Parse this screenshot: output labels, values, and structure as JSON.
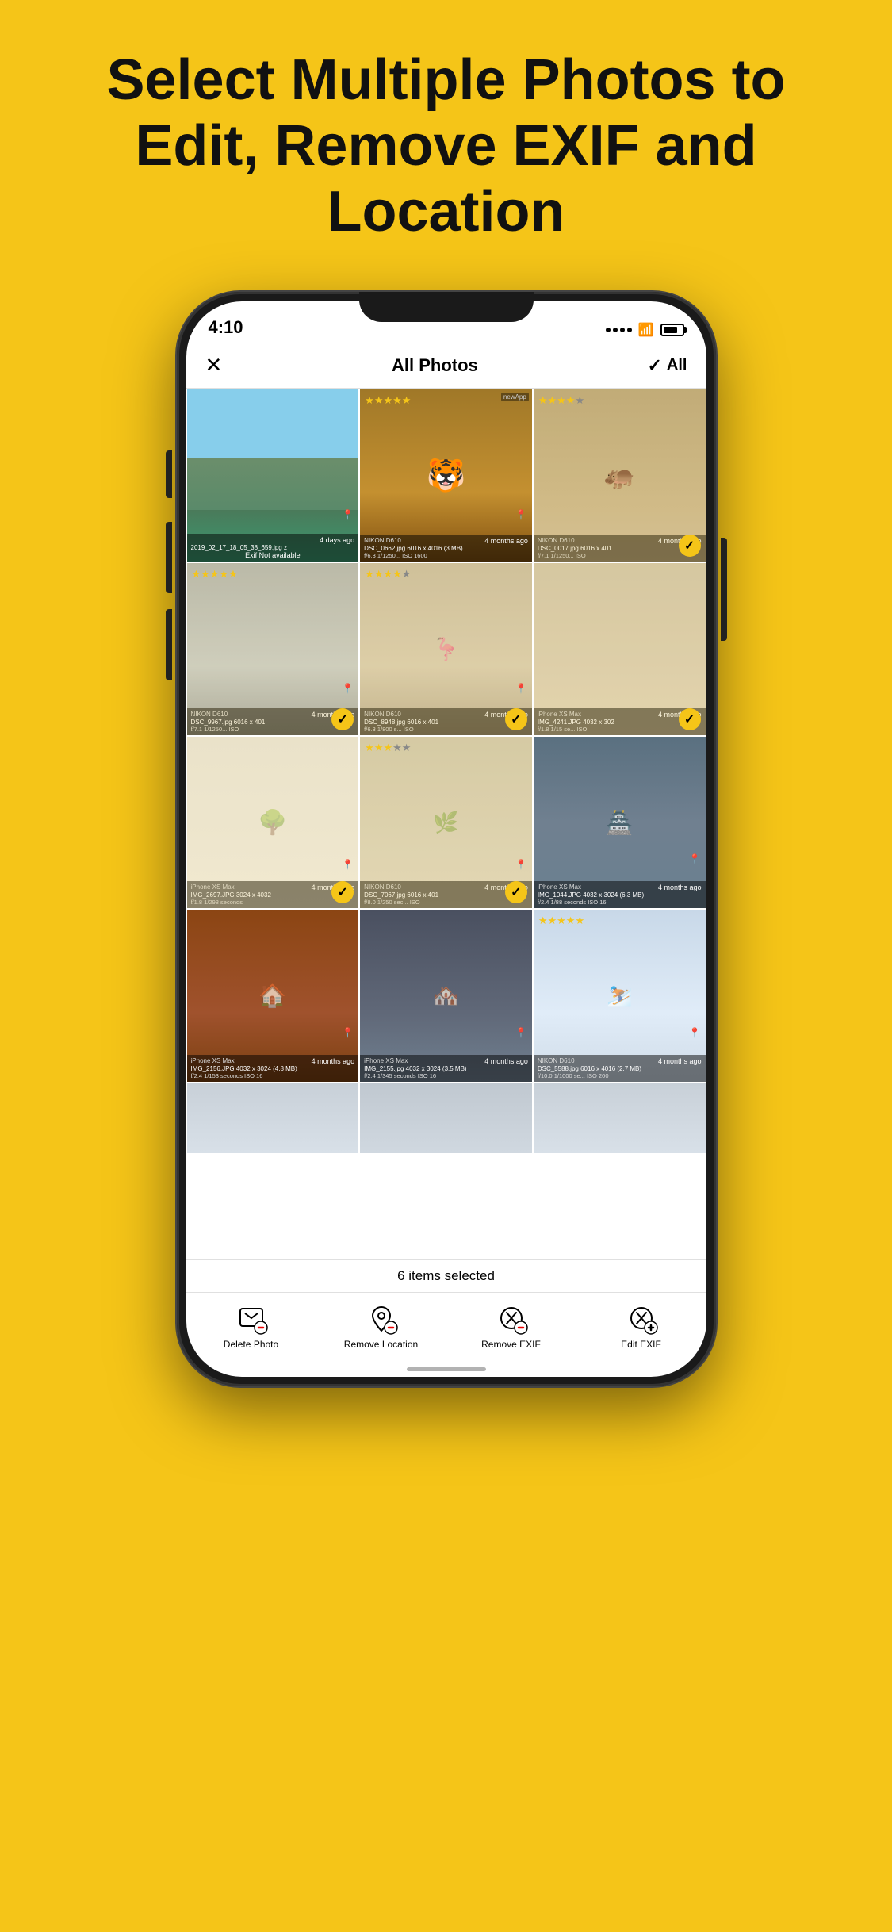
{
  "background_color": "#F5C518",
  "headline": {
    "line1": "Select Multiple Photos to",
    "line2": "Edit, Remove EXIF and Location"
  },
  "status_bar": {
    "time": "4:10"
  },
  "nav": {
    "title": "All Photos",
    "select_all_label": "All"
  },
  "photos": [
    {
      "id": "p1",
      "scene": "mountain",
      "date": "4 days ago",
      "filename": "2019_02_17_18_05_38_659.jpg z",
      "exif1": "Exif Not available",
      "camera": "",
      "has_location": true,
      "selected": false,
      "stars": 0
    },
    {
      "id": "p2",
      "scene": "tiger",
      "date": "4 months ago",
      "filename": "DSC_0662.jpg 6016 x 4016 (3 MB)",
      "exif1": "f/6.3    1/1250...  ISO 1600",
      "camera": "NIKON D610",
      "has_location": true,
      "selected": false,
      "stars": 5
    },
    {
      "id": "p3",
      "scene": "hippo",
      "date": "4 months ago",
      "filename": "DSC_0017.jpg 6016 x 401...",
      "exif1": "f/7.1    1/1250...  ISO",
      "camera": "NIKON D610",
      "has_location": false,
      "selected": true,
      "stars": 4
    },
    {
      "id": "p4",
      "scene": "gray1",
      "date": "4 months ago",
      "filename": "DSC_9967.jpg 6016 x 401",
      "exif1": "f/7.1    1/1250...  ISO",
      "camera": "NIKON D610",
      "has_location": true,
      "selected": true,
      "stars": 5
    },
    {
      "id": "p5",
      "scene": "bird",
      "date": "4 months ago",
      "filename": "DSC_8948.jpg 6016 x 401",
      "exif1": "f/6.3    1/800 s...  ISO",
      "camera": "NIKON D610",
      "has_location": true,
      "selected": true,
      "stars": 4
    },
    {
      "id": "p6",
      "scene": "beige",
      "date": "4 months ago",
      "filename": "IMG_4241.JPG 4032 x 302",
      "exif1": "f/1.8    1/15 se...  ISO",
      "camera": "iPhone XS Max",
      "has_location": false,
      "selected": true,
      "stars": 0
    },
    {
      "id": "p7",
      "scene": "trees1",
      "date": "4 months ago",
      "filename": "IMG_2697.JPG 3024 x 4032",
      "exif1": "f/1.8    1/298 seconds",
      "camera": "iPhone XS Max",
      "has_location": true,
      "selected": true,
      "stars": 0
    },
    {
      "id": "p8",
      "scene": "trees2",
      "date": "4 months ago",
      "filename": "DSC_7067.jpg 6016 x 401",
      "exif1": "f/8.0    1/250 sec...  ISO",
      "camera": "NIKON D610",
      "has_location": true,
      "selected": true,
      "stars": 3
    },
    {
      "id": "p9",
      "scene": "pavilion",
      "date": "4 months ago",
      "filename": "IMG_1044.JPG 4032 x 3024 (6.3 MB)",
      "exif1": "f/2.4    1/88 seconds  ISO 16",
      "camera": "iPhone XS Max",
      "has_location": true,
      "selected": false,
      "stars": 0
    },
    {
      "id": "p10",
      "scene": "house1",
      "date": "4 months ago",
      "filename": "IMG_2156.JPG 4032 x 3024 (4.8 MB)",
      "exif1": "f/2.4    1/153 seconds  ISO 16",
      "camera": "iPhone XS Max",
      "has_location": true,
      "selected": false,
      "stars": 0
    },
    {
      "id": "p11",
      "scene": "house2",
      "date": "4 months ago",
      "filename": "IMG_2155.jpg 4032 x 3024 (3.5 MB)",
      "exif1": "f/2.4    1/345 seconds  ISO 16",
      "camera": "iPhone XS Max",
      "has_location": true,
      "selected": false,
      "stars": 0
    },
    {
      "id": "p12",
      "scene": "snow",
      "date": "4 months ago",
      "filename": "DSC_5588.jpg 6016 x 4016 (2.7 MB)",
      "exif1": "f/10.0    1/1000 se...  ISO 200",
      "camera": "NIKON D610",
      "has_location": true,
      "selected": false,
      "stars": 5
    },
    {
      "id": "p13",
      "scene": "cloudy1",
      "date": "",
      "filename": "",
      "exif1": "",
      "camera": "",
      "has_location": false,
      "selected": false,
      "stars": 0
    },
    {
      "id": "p14",
      "scene": "cloudy2",
      "date": "",
      "filename": "",
      "exif1": "",
      "camera": "",
      "has_location": false,
      "selected": false,
      "stars": 0
    },
    {
      "id": "p15",
      "scene": "cloudy3",
      "date": "",
      "filename": "",
      "exif1": "",
      "camera": "",
      "has_location": false,
      "selected": false,
      "stars": 0
    }
  ],
  "selected_count_label": "6 items selected",
  "toolbar": {
    "delete_photo": "Delete Photo",
    "remove_location": "Remove Location",
    "remove_exif": "Remove EXIF",
    "edit_exif": "Edit EXIF"
  }
}
